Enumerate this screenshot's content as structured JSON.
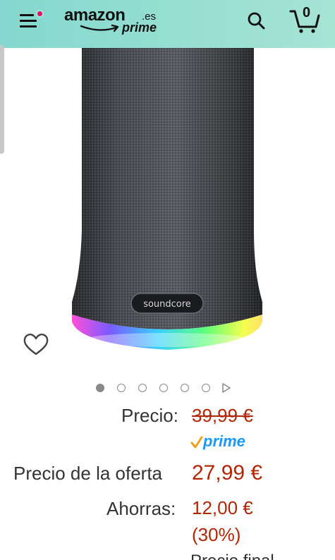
{
  "header": {
    "logo_main": "amazon",
    "logo_tld": ".es",
    "logo_sub": "prime",
    "cart_count": "0",
    "icons": {
      "menu": "hamburger-menu-icon",
      "search": "search-icon",
      "cart": "cart-icon"
    },
    "colors": {
      "header_bg": "#a6e4d4",
      "notification_dot": "#e3106f"
    }
  },
  "product": {
    "image": "speaker-image",
    "brand_label": "soundcore",
    "wishlist_icon": "heart-outline-icon",
    "carousel": {
      "total_images": 6,
      "active_index": 0,
      "has_video": true
    }
  },
  "pricing": {
    "price_label": "Precio:",
    "list_price": "39,99 €",
    "prime_label": "prime",
    "deal_label": "Precio de la oferta",
    "deal_price": "27,99 €",
    "savings_label": "Ahorras:",
    "savings_amount": "12,00 €",
    "savings_percent": "(30%)",
    "colors": {
      "price_red": "#b12704",
      "prime_blue": "#1a98ff",
      "prime_check": "#f0a020"
    }
  },
  "cutoff_text": "Precio final"
}
